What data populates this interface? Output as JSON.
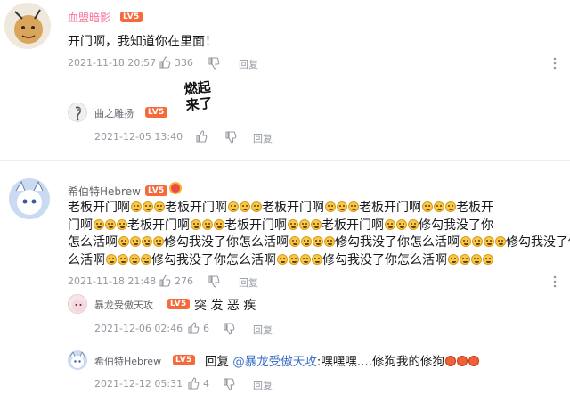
{
  "comments": [
    {
      "username": "血盟暗影",
      "level": "LV5",
      "text": "开门啊，我知道你在里面！",
      "date": "2021-11-18 20:57",
      "likes": "336",
      "reply_label": "回复"
    },
    {
      "username": "希伯特Hebrew",
      "level": "LV5",
      "text_segments": [
        "老板开门啊",
        "老板开门啊",
        "老板开门啊",
        "老板开门啊",
        "老板开",
        "门啊",
        "老板开门啊",
        "老板开门啊",
        "老板开门啊",
        "修勾我没了你",
        "怎么活啊",
        "修勾我没了你怎么活啊",
        "修勾我没了你怎么活啊",
        "修勾我没了你怎",
        "么活啊",
        "修勾我没了你怎么活啊",
        "修勾我没了你怎么活啊"
      ],
      "date": "2021-11-18 21:48",
      "likes": "276",
      "reply_label": "回复"
    }
  ],
  "replies": [
    {
      "username": "曲之雕扬",
      "level": "LV5",
      "sticker_text": [
        "燃起",
        "来了"
      ],
      "date": "2021-12-05 13:40",
      "reply_label": "回复"
    },
    {
      "username": "暴龙受傲天攻",
      "level": "LV5",
      "text": "突 发 恶 疾",
      "date": "2021-12-06 02:46",
      "likes": "6",
      "reply_label": "回复"
    },
    {
      "username": "希伯特Hebrew",
      "level": "LV5",
      "reply_prefix": "回复",
      "mention": "@暴龙受傲天攻",
      "text": ":嘿嘿嘿....修狗我的修狗",
      "date": "2021-12-12 05:31",
      "likes": "4",
      "reply_label": "回复"
    }
  ],
  "icons": {
    "like": "thumb-up-icon",
    "dislike": "thumb-down-icon",
    "more": "more-vertical-icon"
  },
  "colors": {
    "level_badge": "#f6693a",
    "mention_link": "#3a6fc3",
    "username": "#fb7299"
  }
}
